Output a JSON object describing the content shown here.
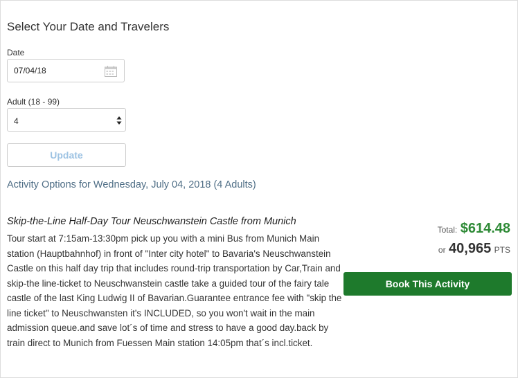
{
  "form": {
    "title": "Select Your Date and Travelers",
    "date_label": "Date",
    "date_value": "07/04/18",
    "adult_label": "Adult (18 - 99)",
    "adult_value": "4",
    "update_label": "Update"
  },
  "activity_options": {
    "heading": "Activity Options for Wednesday, July 04, 2018 (4 Adults)"
  },
  "activity": {
    "title": "Skip-the-Line Half-Day Tour Neuschwanstein Castle from Munich",
    "description": "Tour start at 7:15am-13:30pm pick up you with a mini Bus from Munich Main station (Hauptbahnhof) in front of \"Inter city hotel\" to Bavaria's Neuschwanstein Castle on this  half day trip that includes round-trip transportation by Car,Train and skip-the line-ticket to Neuschwanstein castle take a guided tour of the fairy tale  castle of the last King Ludwig II of Bavarian.Guarantee entrance fee with \"skip the line ticket\" to Neuschwansten it's INCLUDED, so you won't wait in the main admission queue.and save lot´s of time and stress to have a good day.back by train direct to Munich from Fuessen Main station 14:05pm that´s incl.ticket.",
    "total_label": "Total:",
    "total_amount": "$614.48",
    "points_or": "or",
    "points_value": "40,965",
    "points_unit": "PTS",
    "book_label": "Book This Activity"
  },
  "colors": {
    "accent_green": "#1e7a2c",
    "price_green": "#2e8a36",
    "heading_blue": "#4f6e86",
    "disabled_button_text": "#9ec3e3"
  },
  "icons": {
    "date_icon": "calendar-icon",
    "select_icon": "updown-arrows-icon"
  }
}
